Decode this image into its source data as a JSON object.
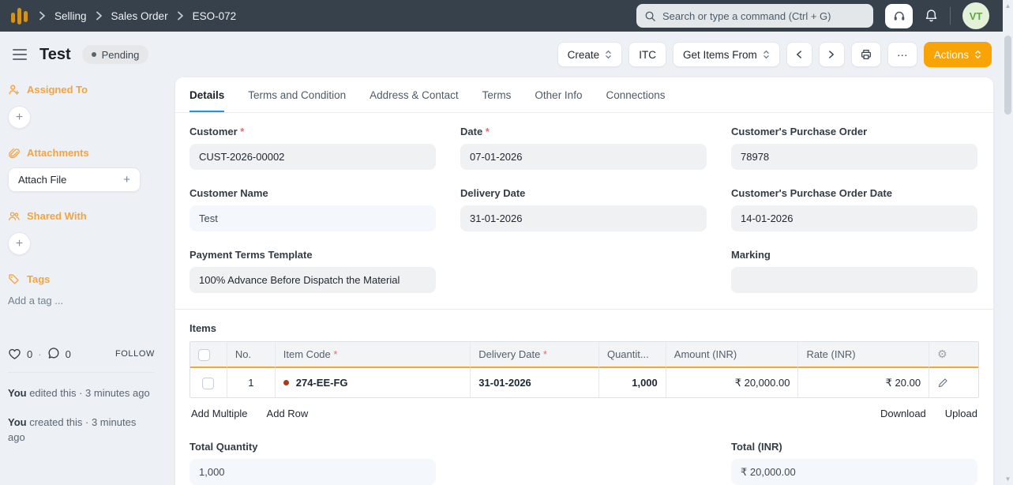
{
  "navbar": {
    "breadcrumbs": [
      {
        "label": "Selling"
      },
      {
        "label": "Sales Order"
      },
      {
        "label": "ESO-072"
      }
    ],
    "search_placeholder": "Search or type a command (Ctrl + G)",
    "avatar_initials": "VT"
  },
  "header": {
    "title": "Test",
    "status": "Pending",
    "create_label": "Create",
    "itc_label": "ITC",
    "get_items_from_label": "Get Items From",
    "ellipsis_label": "···",
    "actions_label": "Actions"
  },
  "sidebar": {
    "assigned_to_label": "Assigned To",
    "attachments_label": "Attachments",
    "attach_file_label": "Attach File",
    "shared_with_label": "Shared With",
    "tags_label": "Tags",
    "add_tag_placeholder": "Add a tag ...",
    "plus": "+",
    "likes_count": "0",
    "comments_count": "0",
    "dot_sep": "·",
    "follow_label": "FOLLOW",
    "activity": [
      {
        "actor": "You",
        "text": " edited this · 3 minutes ago"
      },
      {
        "actor": "You",
        "text": " created this · 3 minutes ago"
      }
    ]
  },
  "tabs": [
    {
      "label": "Details"
    },
    {
      "label": "Terms and Condition"
    },
    {
      "label": "Address & Contact"
    },
    {
      "label": "Terms"
    },
    {
      "label": "Other Info"
    },
    {
      "label": "Connections"
    }
  ],
  "form": {
    "fields": [
      {
        "label": "Customer",
        "req": " *",
        "value": "CUST-2026-00002"
      },
      {
        "label": "Date",
        "req": " *",
        "value": "07-01-2026"
      },
      {
        "label": "Customer's Purchase Order",
        "req": "",
        "value": "78978"
      },
      {
        "label": "Customer Name",
        "req": "",
        "value": "Test"
      },
      {
        "label": "Delivery Date",
        "req": "",
        "value": "31-01-2026"
      },
      {
        "label": "Customer's Purchase Order Date",
        "req": "",
        "value": "14-01-2026"
      },
      {
        "label": "Payment Terms Template",
        "req": "",
        "value": "100% Advance Before Dispatch the Material"
      },
      {
        "label": "Marking",
        "req": "",
        "value": ""
      }
    ]
  },
  "items": {
    "section_label": "Items",
    "headers": [
      {
        "label": "No.",
        "req": ""
      },
      {
        "label": "Item Code",
        "req": " *"
      },
      {
        "label": "Delivery Date",
        "req": " *"
      },
      {
        "label": "Quantit...",
        "req": ""
      },
      {
        "label": "Amount (INR)",
        "req": ""
      },
      {
        "label": "Rate (INR)",
        "req": ""
      }
    ],
    "rows": [
      {
        "no": "1",
        "item_code": "274-EE-FG",
        "delivery_date": "31-01-2026",
        "quantity": "1,000",
        "amount": "₹ 20,000.00",
        "rate": "₹ 20.00"
      }
    ],
    "add_multiple_label": "Add Multiple",
    "add_row_label": "Add Row",
    "download_label": "Download",
    "upload_label": "Upload"
  },
  "totals": {
    "quantity_label": "Total Quantity",
    "quantity_value": "1,000",
    "total_label": "Total (INR)",
    "total_value": "₹ 20,000.00"
  },
  "colors": {
    "accent_orange": "#f8a306",
    "sidebar_heading_orange": "#f6a33c",
    "navbar_bg": "#36414c",
    "active_tab_underline": "#2490ef",
    "required_red": "#e86a6a",
    "item_indicator_dot": "#a83a1e",
    "table_header_underline": "#f3a72e",
    "avatar_bg": "#e3f1d8",
    "avatar_text": "#5fa83f"
  }
}
